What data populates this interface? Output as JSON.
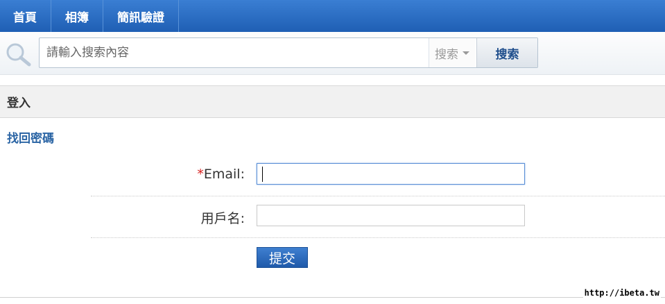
{
  "nav": {
    "items": [
      {
        "label": "首頁"
      },
      {
        "label": "相簿"
      },
      {
        "label": "簡訊驗證"
      }
    ]
  },
  "search": {
    "placeholder": "請輸入搜索內容",
    "scope_label": "搜索",
    "button_label": "搜索"
  },
  "section": {
    "title": "登入",
    "subtitle": "找回密碼"
  },
  "form": {
    "email_required_mark": "*",
    "email_label": "Email:",
    "email_value": "",
    "username_label": "用戶名:",
    "username_value": "",
    "submit_label": "提交"
  },
  "watermark": "http://ibeta.tw",
  "colors": {
    "nav_bg": "#2a6cc4",
    "link": "#2a64a4",
    "required": "#d8201e",
    "submit_bg": "#2d6cc0"
  }
}
